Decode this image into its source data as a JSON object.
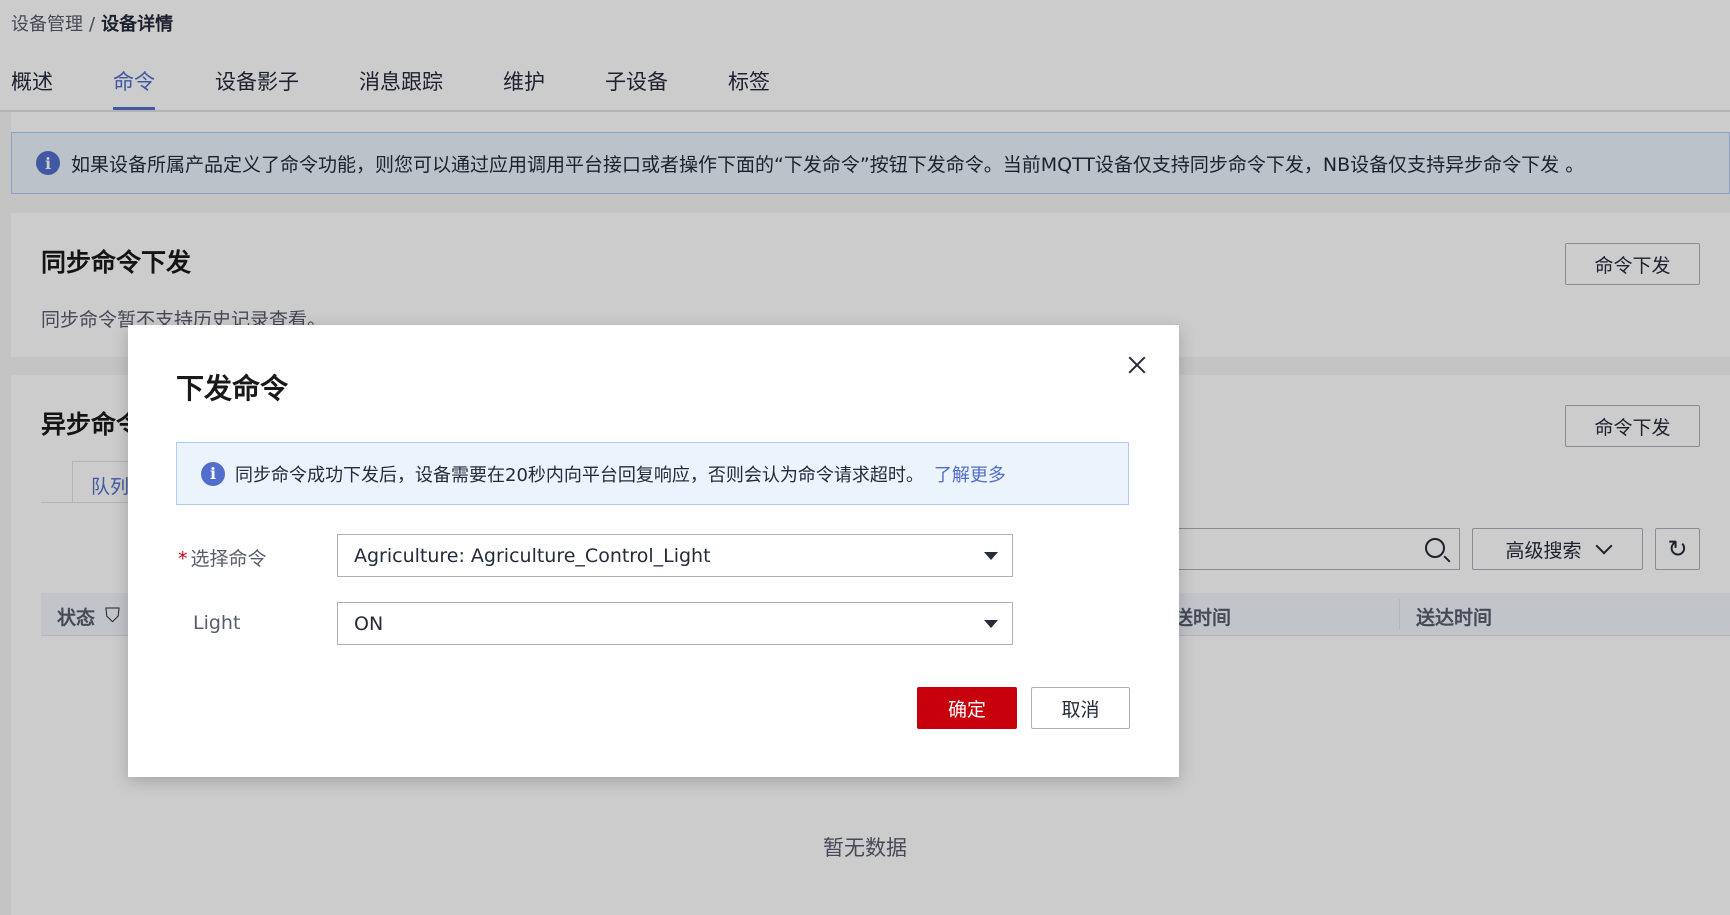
{
  "breadcrumb": {
    "parent": "设备管理",
    "separator": "/",
    "current": "设备详情"
  },
  "tabs": [
    {
      "label": "概述"
    },
    {
      "label": "命令"
    },
    {
      "label": "设备影子"
    },
    {
      "label": "消息跟踪"
    },
    {
      "label": "维护"
    },
    {
      "label": "子设备"
    },
    {
      "label": "标签"
    }
  ],
  "active_tab": "命令",
  "page_alert": {
    "icon": "info-icon",
    "text": "如果设备所属产品定义了命令功能，则您可以通过应用调用平台接口或者操作下面的“下发命令”按钮下发命令。当前MQTT设备仅支持同步命令下发，NB设备仅支持异步命令下发 。"
  },
  "sync_card": {
    "title": "同步命令下发",
    "subtitle": "同步命令暂不支持历史记录查看。",
    "button": "命令下发"
  },
  "async_card": {
    "title": "异步命令",
    "button": "命令下发",
    "subtab": "队列",
    "advanced_search": "高级搜索",
    "refresh_icon": "refresh-icon",
    "columns": [
      "状态",
      "送时间",
      "送达时间"
    ],
    "empty_text": "暂无数据"
  },
  "modal": {
    "title": "下发命令",
    "alert_text": "同步命令成功下发后，设备需要在20秒内向平台回复响应，否则会认为命令请求超时。",
    "alert_link": "了解更多",
    "fields": {
      "command_label": "选择命令",
      "command_value": "Agriculture: Agriculture_Control_Light",
      "light_label": "Light",
      "light_value": "ON"
    },
    "confirm": "确定",
    "cancel": "取消"
  },
  "colors": {
    "primary": "#c7000b",
    "accent": "#526ecc",
    "alert_bg": "#ebf3fd"
  }
}
